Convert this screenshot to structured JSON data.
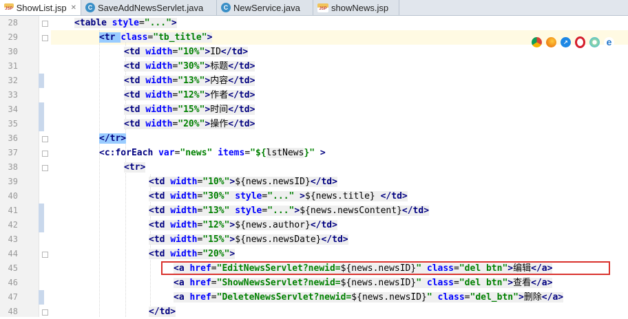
{
  "tabs": [
    {
      "label": "ShowList.jsp",
      "icon": "jsp-file-icon",
      "active": true,
      "closable": true
    },
    {
      "label": "SaveAddNewsServlet.java",
      "icon": "java-class-icon"
    },
    {
      "label": "NewService.java",
      "icon": "java-class-icon"
    },
    {
      "label": "showNews.jsp",
      "icon": "jsp-file-icon"
    }
  ],
  "browsers": [
    "chrome-icon",
    "firefox-icon",
    "safari-icon",
    "opera-icon",
    "ie-icon",
    "edge-icon"
  ],
  "line_numbers": [
    "28",
    "29",
    "30",
    "31",
    "32",
    "33",
    "34",
    "35",
    "36",
    "37",
    "38",
    "39",
    "40",
    "41",
    "42",
    "43",
    "44",
    "45",
    "46",
    "47",
    "48"
  ],
  "code": {
    "l28_a": "<table ",
    "l28_b": "style",
    "l28_c": "=",
    "l28_d": "\"...\"",
    "l28_e": ">",
    "l29_a": "<tr ",
    "l29_b": "class",
    "l29_c": "=",
    "l29_d": "\"tb_title\"",
    "l29_e": ">",
    "l30_a": "<td ",
    "l30_b": "width",
    "l30_c": "=",
    "l30_d": "\"10%\"",
    "l30_e": ">",
    "l30_f": "ID",
    "l30_g": "</td>",
    "l31_a": "<td ",
    "l31_b": "width",
    "l31_c": "=",
    "l31_d": "\"30%\"",
    "l31_e": ">",
    "l31_f": "标题",
    "l31_g": "</td>",
    "l32_a": "<td ",
    "l32_b": "width",
    "l32_c": "=",
    "l32_d": "\"13%\"",
    "l32_e": ">",
    "l32_f": "内容",
    "l32_g": "</td>",
    "l33_a": "<td ",
    "l33_b": "width",
    "l33_c": "=",
    "l33_d": "\"12%\"",
    "l33_e": ">",
    "l33_f": "作者",
    "l33_g": "</td>",
    "l34_a": "<td ",
    "l34_b": "width",
    "l34_c": "=",
    "l34_d": "\"15%\"",
    "l34_e": ">",
    "l34_f": "时间",
    "l34_g": "</td>",
    "l35_a": "<td ",
    "l35_b": "width",
    "l35_c": "=",
    "l35_d": "\"20%\"",
    "l35_e": ">",
    "l35_f": "操作",
    "l35_g": "</td>",
    "l36_a": "</tr>",
    "l37_a": "<c:forEach ",
    "l37_b": "var",
    "l37_c": "=",
    "l37_d": "\"news\" ",
    "l37_e": "items",
    "l37_f": "=",
    "l37_g": "\"${",
    "l37_h": "lstNews",
    "l37_i": "}\"",
    "l37_j": " >",
    "l38_a": "<tr>",
    "l39_a": "<td ",
    "l39_b": "width",
    "l39_c": "=",
    "l39_d": "\"10%\"",
    "l39_e": ">",
    "l39_f": "${news.newsID}",
    "l39_g": "</td>",
    "l40_a": "<td ",
    "l40_b": "width",
    "l40_c": "=",
    "l40_d": "\"30%\" ",
    "l40_e": "style",
    "l40_f": "=",
    "l40_g": "\"...\"",
    "l40_h": " >",
    "l40_i": "${news.title} ",
    "l40_j": "</td>",
    "l41_a": "<td ",
    "l41_b": "width",
    "l41_c": "=",
    "l41_d": "\"13%\" ",
    "l41_e": "style",
    "l41_f": "=",
    "l41_g": "\"...\"",
    "l41_h": ">",
    "l41_i": "${news.newsContent}",
    "l41_j": "</td>",
    "l42_a": "<td ",
    "l42_b": "width",
    "l42_c": "=",
    "l42_d": "\"12%\"",
    "l42_e": ">",
    "l42_f": "${news.author}",
    "l42_g": "</td>",
    "l43_a": "<td ",
    "l43_b": "width",
    "l43_c": "=",
    "l43_d": "\"15%\"",
    "l43_e": ">",
    "l43_f": "${news.newsDate}",
    "l43_g": "</td>",
    "l44_a": "<td ",
    "l44_b": "width",
    "l44_c": "=",
    "l44_d": "\"20%\"",
    "l44_e": ">",
    "l45_a": "<a ",
    "l45_b": "href",
    "l45_c": "=",
    "l45_d": "\"EditNewsServlet?newid=",
    "l45_e": "${news.newsID}",
    "l45_f": "\" ",
    "l45_g": "class",
    "l45_h": "=",
    "l45_i": "\"del btn\"",
    "l45_j": ">",
    "l45_k": "编辑",
    "l45_l": "</a>",
    "l46_a": "<a ",
    "l46_b": "href",
    "l46_c": "=",
    "l46_d": "\"ShowNewsServlet?newid=",
    "l46_e": "${news.newsID}",
    "l46_f": "\" ",
    "l46_g": "class",
    "l46_h": "=",
    "l46_i": "\"del btn\"",
    "l46_j": ">",
    "l46_k": "查看",
    "l46_l": "</a>",
    "l47_a": "<a ",
    "l47_b": "href",
    "l47_c": "=",
    "l47_d": "\"DeleteNewsServlet?newid=",
    "l47_e": "${news.newsID}",
    "l47_f": "\" ",
    "l47_g": "class",
    "l47_h": "=",
    "l47_i": "\"del_btn\"",
    "l47_j": ">",
    "l47_k": "删除",
    "l47_l": "</a>",
    "l48_a": "</td>"
  }
}
